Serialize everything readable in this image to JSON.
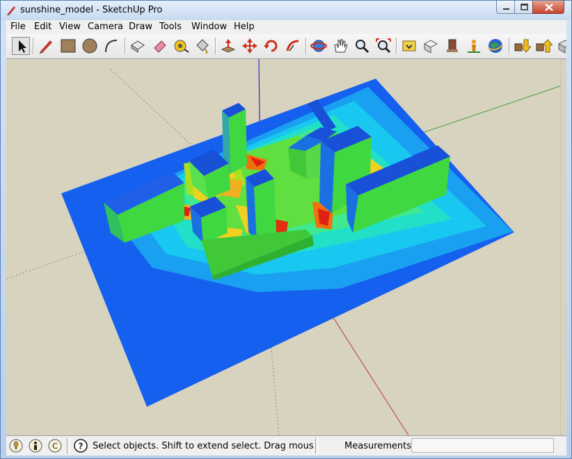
{
  "window": {
    "title": "sunshine_model - SketchUp Pro"
  },
  "menu": [
    "File",
    "Edit",
    "View",
    "Camera",
    "Draw",
    "Tools",
    "Window",
    "Help"
  ],
  "toolbar": [
    {
      "icon": "select-arrow-icon"
    },
    {
      "icon": "pencil-line-icon"
    },
    {
      "icon": "rectangle-icon"
    },
    {
      "icon": "circle-icon"
    },
    {
      "icon": "arc-icon"
    },
    {
      "icon": "make-component-icon"
    },
    {
      "icon": "eraser-icon"
    },
    {
      "icon": "tape-measure-icon"
    },
    {
      "icon": "paint-bucket-icon"
    },
    {
      "icon": "push-pull-icon"
    },
    {
      "icon": "move-icon"
    },
    {
      "icon": "rotate-icon"
    },
    {
      "icon": "follow-me-icon"
    },
    {
      "icon": "orbit-icon"
    },
    {
      "icon": "pan-icon"
    },
    {
      "icon": "zoom-icon"
    },
    {
      "icon": "zoom-extents-icon"
    },
    {
      "icon": "get-models-icon"
    },
    {
      "icon": "share-model-icon"
    },
    {
      "icon": "components-icon"
    },
    {
      "icon": "add-location-icon"
    },
    {
      "icon": "google-earth-icon"
    },
    {
      "icon": "get-models-down-icon"
    },
    {
      "icon": "share-model-up-icon"
    }
  ],
  "status": {
    "text": "Select objects. Shift to extend select. Drag mouse to select multiple.",
    "measurements_label": "Measurements",
    "measurements_value": ""
  }
}
